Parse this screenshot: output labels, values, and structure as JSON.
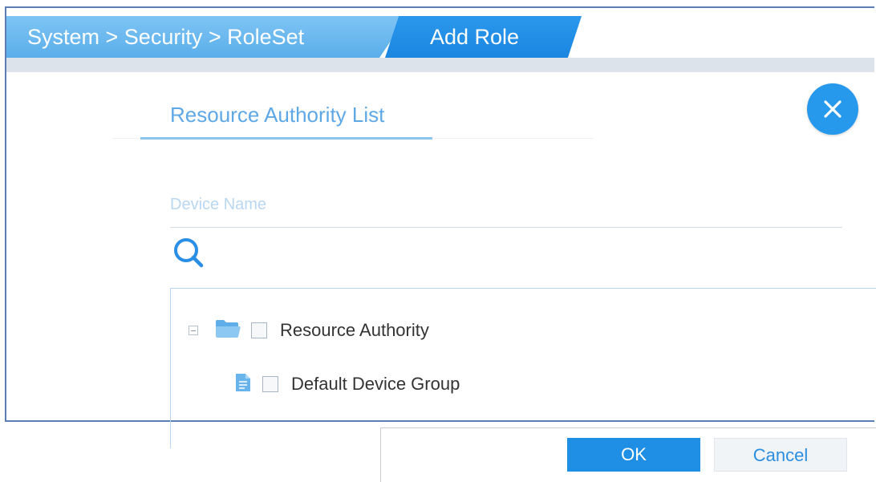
{
  "header": {
    "breadcrumb": "System > Security > RoleSet",
    "active_tab": "Add Role"
  },
  "panel": {
    "tab_title": "Resource Authority List",
    "search": {
      "placeholder": "Device Name",
      "icon": "search-icon"
    },
    "close_icon": "close-icon"
  },
  "tree": {
    "root": {
      "label": "Resource Authority",
      "icon": "folder-open-icon",
      "expanded": true,
      "checked": false
    },
    "children": [
      {
        "label": "Default Device Group",
        "icon": "document-icon",
        "checked": false
      }
    ]
  },
  "footer": {
    "ok_label": "OK",
    "cancel_label": "Cancel"
  },
  "colors": {
    "accent": "#1f8fe6",
    "breadcrumb_bg": "#66b7ee",
    "tab_title": "#5fa8e6"
  }
}
